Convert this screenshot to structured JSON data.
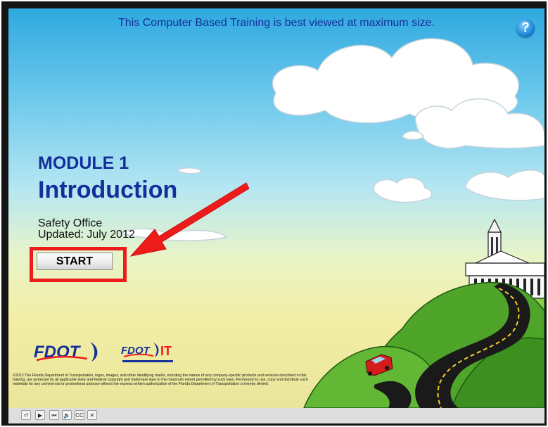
{
  "banner": {
    "text": "This Computer Based Training is best viewed at maximum size."
  },
  "help": {
    "label": "?"
  },
  "module": {
    "label": "MODULE 1",
    "title": "Introduction"
  },
  "meta": {
    "office": "Safety Office",
    "updated": "Updated: July 2012"
  },
  "start": {
    "label": "START"
  },
  "logos": {
    "primary": "FDOT",
    "secondary_prefix": "FDOT",
    "secondary_suffix": "IT"
  },
  "copyright": "©2012 The Florida Department of Transportation, logos, images, and other identifying marks, including the names of any company-specific products and services described in this training, are protected by all applicable state and Federal copyright and trademark laws to the maximum extent permitted by such laws. Permission to use, copy and distribute such materials for any commercial or promotional purpose without the express written authorization of the Florida Department of Transportation is hereby denied.",
  "controls": [
    {
      "name": "exit-icon",
      "glyph": "⏎"
    },
    {
      "name": "play-icon",
      "glyph": "▶"
    },
    {
      "name": "rewind-icon",
      "glyph": "⏮"
    },
    {
      "name": "volume-icon",
      "glyph": "🔈"
    },
    {
      "name": "captions-icon",
      "glyph": "CC"
    },
    {
      "name": "close-icon",
      "glyph": "✕"
    }
  ],
  "colors": {
    "heading": "#152f9a",
    "highlight": "#ee1b1b",
    "hill": "#4a9b2a"
  }
}
